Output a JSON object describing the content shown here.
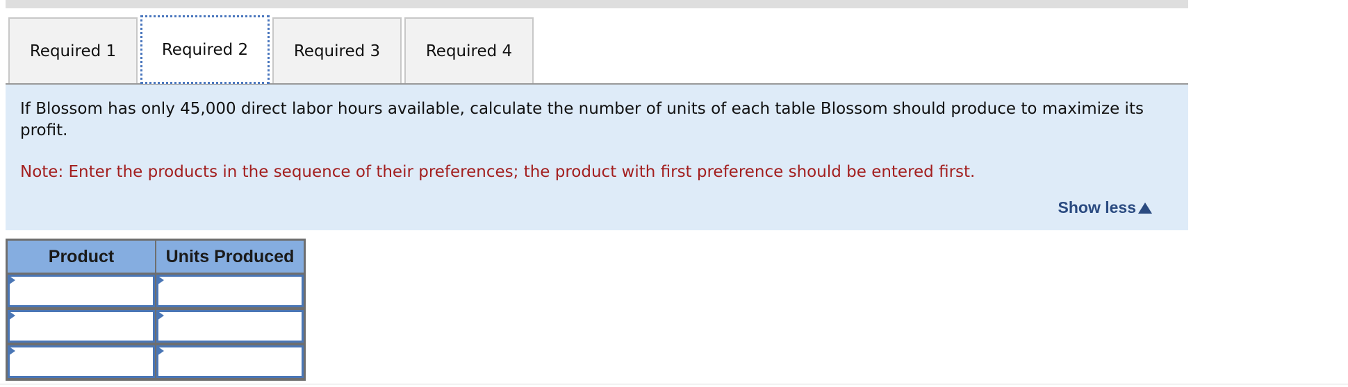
{
  "tabs": [
    {
      "label": "Required 1",
      "active": false
    },
    {
      "label": "Required 2",
      "active": true
    },
    {
      "label": "Required 3",
      "active": false
    },
    {
      "label": "Required 4",
      "active": false
    }
  ],
  "panel": {
    "question": "If Blossom has only 45,000 direct labor hours available, calculate the number of units of each table Blossom should produce to maximize its profit.",
    "note": "Note: Enter the products in the sequence of their preferences; the product with first preference should be entered first.",
    "show_less_label": "Show less",
    "show_less_icon": "triangle-up-icon"
  },
  "table": {
    "headers": [
      "Product",
      "Units Produced"
    ],
    "rows": [
      {
        "product": "",
        "units": ""
      },
      {
        "product": "",
        "units": ""
      },
      {
        "product": "",
        "units": ""
      }
    ]
  },
  "colors": {
    "panel_bg": "#deebf8",
    "note_text": "#a31f1f",
    "link": "#2a4a80",
    "table_header_bg": "#85ade0",
    "input_border": "#4a76b5",
    "active_tab_focus": "#4a76bd"
  }
}
